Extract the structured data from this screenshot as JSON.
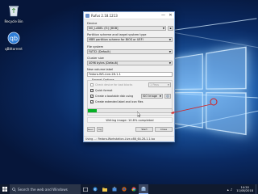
{
  "desktop": {
    "icons": [
      {
        "label": "Recycle Bin",
        "icon": "recycle-bin-icon"
      },
      {
        "label": "qBittorrent",
        "icon": "qbittorrent-icon"
      }
    ]
  },
  "rufus": {
    "title": "Rufus 2.18.1213",
    "controls": {
      "minimize": "—",
      "close": "✕"
    },
    "device_label": "Device",
    "device_value": "NO_LABEL (E:) [8GB]",
    "partition_label": "Partition scheme and target system type",
    "partition_value": "MBR partition scheme for BIOS or UEFI",
    "fs_label": "File system",
    "fs_value": "FAT32 (Default)",
    "cluster_label": "Cluster size",
    "cluster_value": "4096 bytes (Default)",
    "volume_label": "New volume label",
    "volume_value": "Fedora-WS-Live-28-1-1",
    "format_options_label": "Format Options",
    "check_bad_blocks": "Check device for bad blocks",
    "passes_value": "1 Pass",
    "quick_format": "Quick format",
    "bootable_label": "Create a bootable disk using",
    "bootable_value": "ISO Image",
    "extended_label": "Create extended label and icon files",
    "progress_percent": 10.8,
    "status_text": "Writing image: 10.8% completed",
    "buttons": {
      "about": "About...",
      "log": "Log",
      "start": "Start",
      "close": "Close"
    },
    "statusbar_text": "Using ...: Fedora-Workstation-Live-x86_64-28-1.1.iso"
  },
  "taskbar": {
    "search_placeholder": "Search the web and Windows",
    "time": "14:20",
    "date": "11/08/2018",
    "items": [
      {
        "name": "task-view-icon"
      },
      {
        "name": "edge-icon"
      },
      {
        "name": "file-explorer-icon"
      },
      {
        "name": "store-icon"
      },
      {
        "name": "firefox-icon"
      },
      {
        "name": "chrome-icon"
      },
      {
        "name": "rufus-icon",
        "active": true
      }
    ]
  },
  "colors": {
    "progress_fill": "#06b025",
    "annotation": "#d42020",
    "taskbar": "#101a2e"
  }
}
